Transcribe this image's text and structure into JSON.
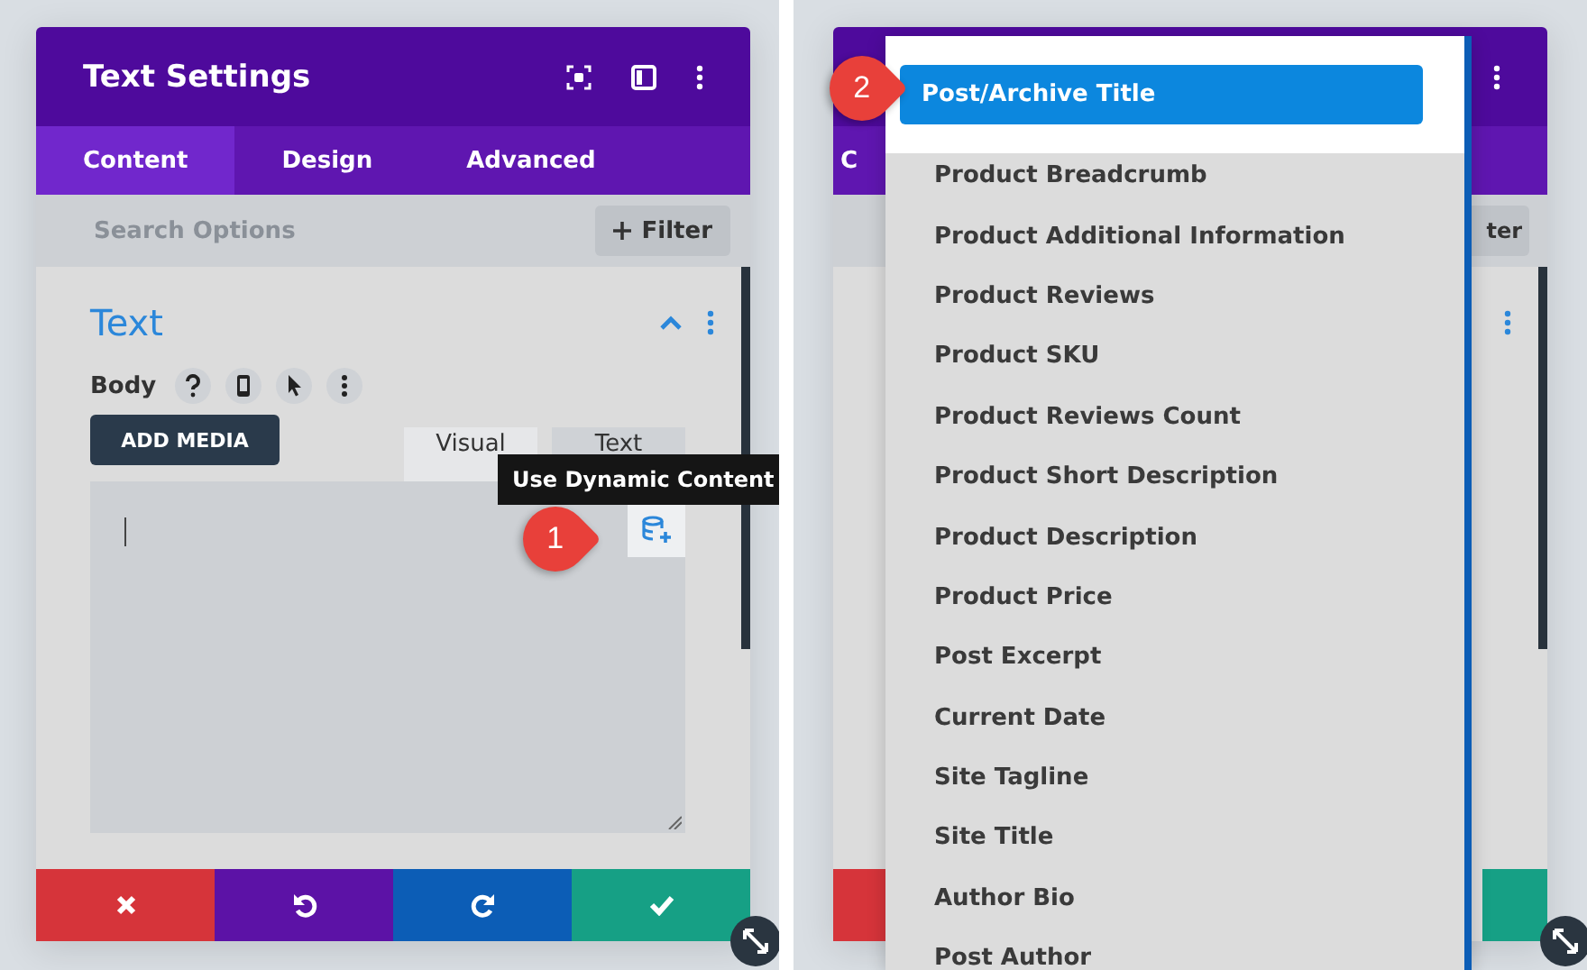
{
  "left_panel": {
    "title": "Text Settings",
    "tabs": [
      {
        "label": "Content",
        "selected": true
      },
      {
        "label": "Design",
        "selected": false
      },
      {
        "label": "Advanced",
        "selected": false
      }
    ],
    "search": {
      "placeholder": "Search Options"
    },
    "filter_button": "Filter",
    "section": {
      "title": "Text",
      "expanded": true
    },
    "field_label": "Body",
    "add_media_button": "ADD MEDIA",
    "editor_tabs": [
      {
        "label": "Visual",
        "selected": true
      },
      {
        "label": "Text",
        "selected": false
      }
    ],
    "tooltip": "Use Dynamic Content",
    "callout": "1",
    "footer_buttons": [
      {
        "kind": "cancel"
      },
      {
        "kind": "undo"
      },
      {
        "kind": "redo"
      },
      {
        "kind": "save"
      }
    ]
  },
  "right_panel": {
    "tab_fragment": "C",
    "filter_fragment": "ter",
    "dropdown": {
      "items": [
        {
          "label": "Post/Archive Title",
          "selected": true
        },
        {
          "label": "Product Breadcrumb",
          "selected": false
        },
        {
          "label": "Product Additional Information",
          "selected": false
        },
        {
          "label": "Product Reviews",
          "selected": false
        },
        {
          "label": "Product SKU",
          "selected": false
        },
        {
          "label": "Product Reviews Count",
          "selected": false
        },
        {
          "label": "Product Short Description",
          "selected": false
        },
        {
          "label": "Product Description",
          "selected": false
        },
        {
          "label": "Product Price",
          "selected": false
        },
        {
          "label": "Post Excerpt",
          "selected": false
        },
        {
          "label": "Current Date",
          "selected": false
        },
        {
          "label": "Site Tagline",
          "selected": false
        },
        {
          "label": "Site Title",
          "selected": false
        },
        {
          "label": "Author Bio",
          "selected": false
        },
        {
          "label": "Post Author",
          "selected": false
        }
      ]
    },
    "callout": "2",
    "footer_buttons": [
      {
        "kind": "cancel"
      },
      {
        "kind": "save"
      }
    ]
  }
}
